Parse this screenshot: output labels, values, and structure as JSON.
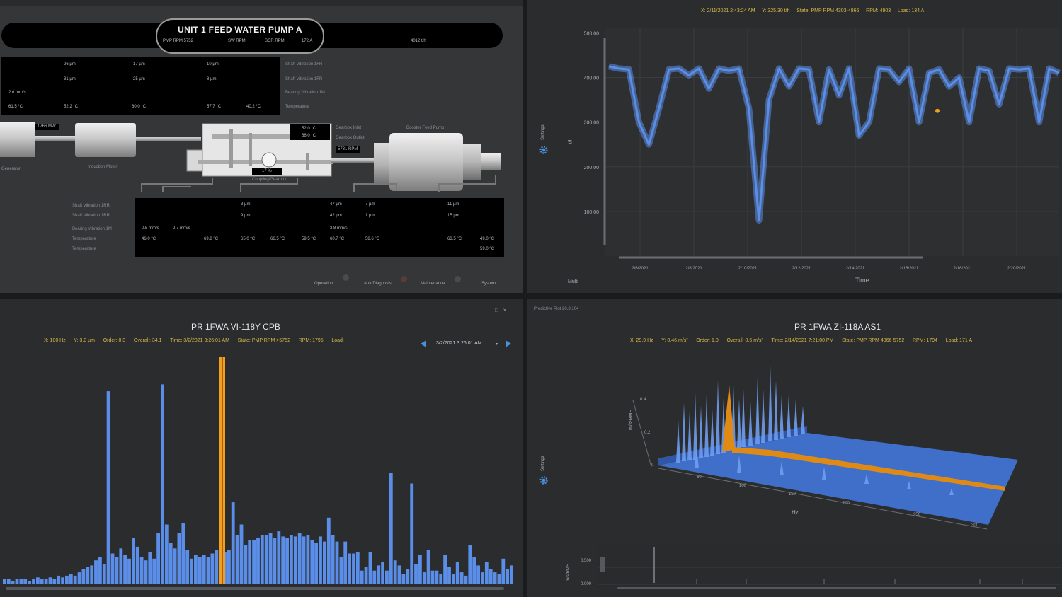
{
  "top_left": {
    "title": "UNIT 1 FEED WATER PUMP A",
    "banner_fields": [
      "PMP RPM 5752",
      "SW RPM",
      "SCR RPM",
      "172 A",
      "4012 t/h"
    ],
    "upper_box": {
      "row1": [
        "26 µm",
        "17 µm",
        "10 µm"
      ],
      "row2": [
        "31 µm",
        "25 µm",
        "8 µm"
      ],
      "row3": [
        "2.6 mm/s"
      ],
      "temps": [
        "61.5 °C",
        "52.2 °C",
        "60.0 °C",
        "57.7 °C",
        "40.2 °C"
      ]
    },
    "upper_labels": [
      "Shaft Vibration 1FR",
      "Shaft Vibration 1FR",
      "Bearing Vibration 1M",
      "Temperature"
    ],
    "machine_tags": [
      "1766 MW",
      "52.0 °C",
      "66.0 °C",
      "5731 RPM",
      "17 %"
    ],
    "machine_labels": [
      "Generator",
      "Induction Motor",
      "Booster Feed Pump",
      "Gearbox Inlet",
      "Gearbox Outlet",
      "Coupling/Gearbox"
    ],
    "lower_labels": [
      "Shaft Vibration 1RR",
      "Shaft Vibration 1RR",
      "Bearing Vibration 1M",
      "Temperature",
      "Temperature"
    ],
    "lower_box": {
      "row1": [
        "3 µm",
        "47 µm",
        "7 µm",
        "11 µm"
      ],
      "row2": [
        "9 µm",
        "42 µm",
        "1 µm",
        "15 µm"
      ],
      "row3": [
        "0.5 mm/s",
        "2.7 mm/s",
        "3.8 mm/s"
      ],
      "temps": [
        "46.0 °C",
        "69.8 °C",
        "65.0 °C",
        "66.5 °C",
        "59.5 °C",
        "60.7 °C",
        "58.6 °C",
        "63.5 °C",
        "49.0 °C"
      ],
      "extra": "59.0 °C"
    },
    "tabs": [
      "Operation",
      "AutoDiagnosis",
      "Maintenance",
      "System"
    ]
  },
  "top_right": {
    "title": "PR 1FWA FE-106 OUTLET FLOW",
    "info": [
      "X: 2/11/2021 2:43:24 AM",
      "Y: 325.30 t/h",
      "State: PMP RPM 4303-4866",
      "RPM: 4903",
      "Load: 134 A"
    ],
    "settings_label": "Settings",
    "ylabel": "t/h",
    "xlabel": "Time",
    "multi_label": "Multi",
    "ytick_labels": [
      "500.00",
      "400.00",
      "300.00",
      "200.00",
      "100.00"
    ],
    "xtick_labels": [
      "2/6/2021",
      "2/8/2021",
      "2/10/2021",
      "2/12/2021",
      "2/14/2021",
      "2/16/2021",
      "2/18/2021",
      "2/20/2021",
      "2/2"
    ],
    "colors": {
      "series": "#5b8ee8",
      "marker": "#f0a020"
    }
  },
  "bottom_left": {
    "title": "PR 1FWA VI-118Y CPB",
    "info": [
      "X: 100 Hz",
      "Y: 3.0 µm",
      "Order: 0.3",
      "Overall: 34.1",
      "Time: 3/2/2021 3:26:01 AM",
      "State: PMP RPM >5752",
      "RPM: 1795",
      "Load:"
    ],
    "date_select": "3/2/2021 3:26:01 AM",
    "window_controls": [
      "_",
      "□",
      "×"
    ],
    "colors": {
      "bars": "#5b8ee8",
      "cursor": "#f0a020"
    }
  },
  "bottom_right": {
    "window_title": "Predictive Plot 20.3.104",
    "title": "PR 1FWA ZI-118A AS1",
    "info": [
      "X: 29.9 Hz",
      "Y: 0.46 m/s²",
      "Order: 1.0",
      "Overall: 0.6 m/s²",
      "Time: 2/14/2021 7:21:00 PM",
      "State: PMP RPM 4866-5752",
      "RPM: 1794",
      "Load: 171 A"
    ],
    "settings_label": "Settings",
    "zlabel": "m/s²RMS",
    "ztick_labels": [
      "0.4",
      "0.2",
      "0"
    ],
    "xlabel": "Hz",
    "xtick_labels": [
      "50",
      "100",
      "150",
      "200",
      "250",
      "300"
    ],
    "mini_ylabel": "m/s²RMS",
    "mini_yticks": [
      "0.500",
      "0.000"
    ],
    "colors": {
      "surface": "#3f6fc8",
      "ridge": "#e08a16"
    }
  },
  "chart_data": [
    {
      "type": "line",
      "title": "PR 1FWA FE-106 OUTLET FLOW",
      "xlabel": "Time",
      "ylabel": "t/h",
      "ylim": [
        0,
        500
      ],
      "x_ticks": [
        "2/6/2021",
        "2/8/2021",
        "2/10/2021",
        "2/12/2021",
        "2/14/2021",
        "2/16/2021",
        "2/18/2021",
        "2/20/2021"
      ],
      "series": [
        {
          "values": [
            425,
            420,
            418,
            300,
            250,
            330,
            418,
            420,
            405,
            420,
            375,
            420,
            415,
            420,
            330,
            80,
            350,
            420,
            380,
            420,
            418,
            300,
            418,
            360,
            420,
            270,
            300,
            420,
            418,
            390,
            420,
            300,
            410,
            418,
            380,
            400,
            300,
            420,
            415,
            340,
            420,
            418,
            420,
            300,
            420,
            410
          ]
        }
      ],
      "annotations": [
        {
          "label": "cursor",
          "x": "2/17/2021",
          "y": 325.3
        }
      ]
    },
    {
      "type": "bar",
      "title": "PR 1FWA VI-118Y CPB",
      "x_unit": "Hz",
      "y_unit": "µm",
      "series": [
        {
          "values": [
            0.3,
            0.3,
            0.2,
            0.3,
            0.3,
            0.3,
            0.2,
            0.3,
            0.4,
            0.3,
            0.3,
            0.4,
            0.3,
            0.5,
            0.4,
            0.5,
            0.6,
            0.5,
            0.7,
            0.9,
            1.0,
            1.1,
            1.4,
            1.6,
            1.2,
            11.3,
            1.8,
            1.6,
            2.1,
            1.7,
            1.5,
            2.7,
            2.2,
            1.6,
            1.4,
            1.9,
            1.5,
            3.0,
            11.7,
            3.5,
            2.4,
            2.1,
            3.0,
            3.6,
            2.0,
            1.5,
            1.7,
            1.6,
            1.7,
            1.6,
            1.8,
            2.0,
            1.5,
            1.9,
            2.0,
            4.8,
            2.9,
            3.5,
            2.3,
            2.6,
            2.6,
            2.7,
            2.9,
            2.9,
            3.0,
            2.7,
            3.1,
            2.8,
            2.7,
            2.9,
            2.8,
            3.0,
            2.8,
            2.9,
            2.6,
            2.4,
            2.8,
            2.5,
            3.9,
            2.9,
            2.5,
            1.6,
            2.5,
            1.8,
            1.8,
            1.9,
            0.8,
            1.0,
            1.9,
            0.8,
            1.1,
            1.3,
            0.8,
            6.5,
            1.4,
            1.1,
            0.6,
            0.9,
            5.9,
            1.2,
            1.7,
            0.7,
            2.0,
            0.8,
            0.8,
            0.6,
            1.7,
            1.0,
            0.6,
            1.3,
            0.7,
            0.5,
            2.3,
            1.6,
            1.1,
            0.7,
            1.3,
            0.9,
            0.7,
            0.6,
            1.5,
            0.9,
            1.1
          ]
        }
      ],
      "annotations": [
        {
          "label": "cursor",
          "x": "100 Hz",
          "y": 3.0
        }
      ]
    },
    {
      "type": "other",
      "title": "PR 1FWA ZI-118A AS1",
      "xlabel": "Hz",
      "zlabel": "m/s²RMS",
      "x_ticks": [
        50,
        100,
        150,
        200,
        250,
        300
      ],
      "z_ticks": [
        0,
        0.2,
        0.4
      ],
      "highlight_order_x_hz": 29.9
    }
  ]
}
